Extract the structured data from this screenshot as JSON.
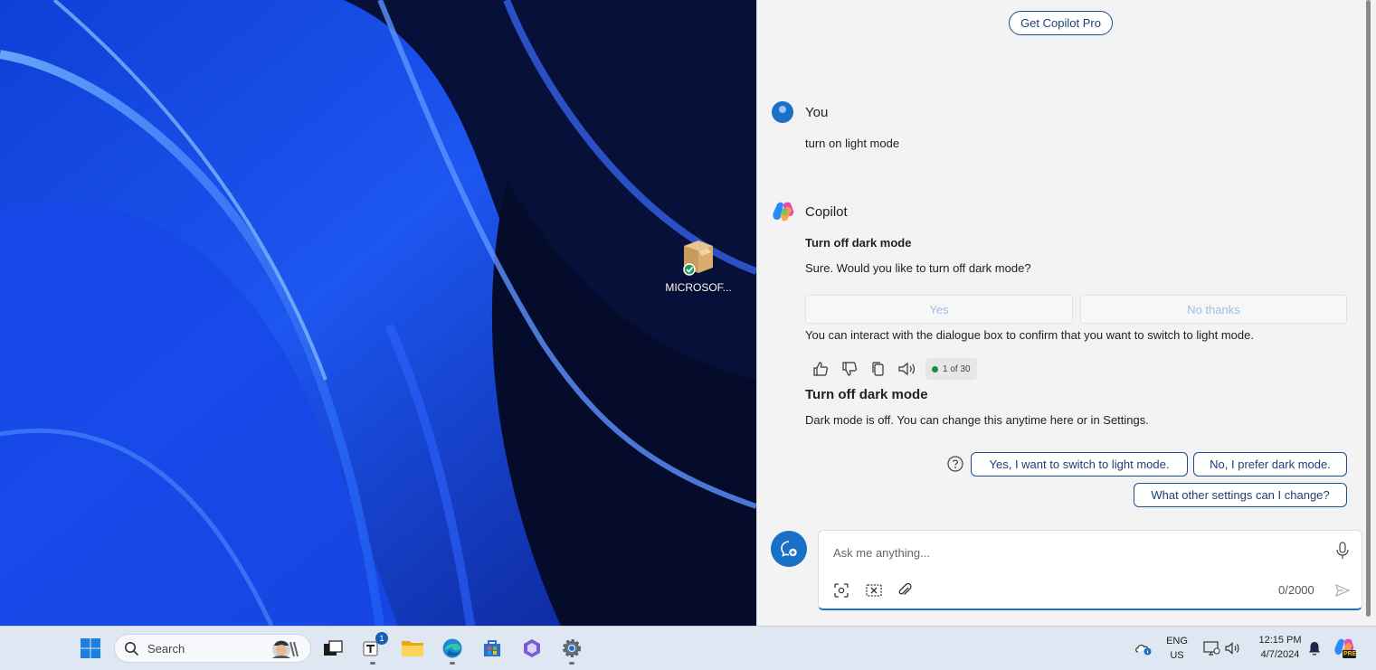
{
  "desktop": {
    "icon_label": "MICROSOF..."
  },
  "copilot": {
    "get_pro_label": "Get Copilot Pro",
    "user_name": "You",
    "user_message": "turn on light mode",
    "bot_name": "Copilot",
    "card_title": "Turn off dark mode",
    "card_question": "Sure. Would you like to turn off dark mode?",
    "yes_label": "Yes",
    "no_label": "No thanks",
    "interact_note": "You can interact with the dialogue box to confirm that you want to switch to light mode.",
    "response_count": "1 of 30",
    "result_title": "Turn off dark mode",
    "result_text": "Dark mode is off. You can change this anytime here or in Settings.",
    "suggestions": [
      "Yes, I want to switch to light mode.",
      "No, I prefer dark mode.",
      "What other settings can I change?"
    ],
    "input_placeholder": "Ask me anything...",
    "char_count": "0/2000"
  },
  "taskbar": {
    "search_label": "Search",
    "teams_badge": "1",
    "lang_top": "ENG",
    "lang_bottom": "US",
    "time": "12:15 PM",
    "date": "4/7/2024",
    "copilot_tag": "PRE"
  },
  "colors": {
    "accent": "#1a6fc7",
    "panel_bg": "#f3f3f3",
    "taskbar_bg": "#dfe7f2",
    "link_border": "#1f4e8c"
  }
}
